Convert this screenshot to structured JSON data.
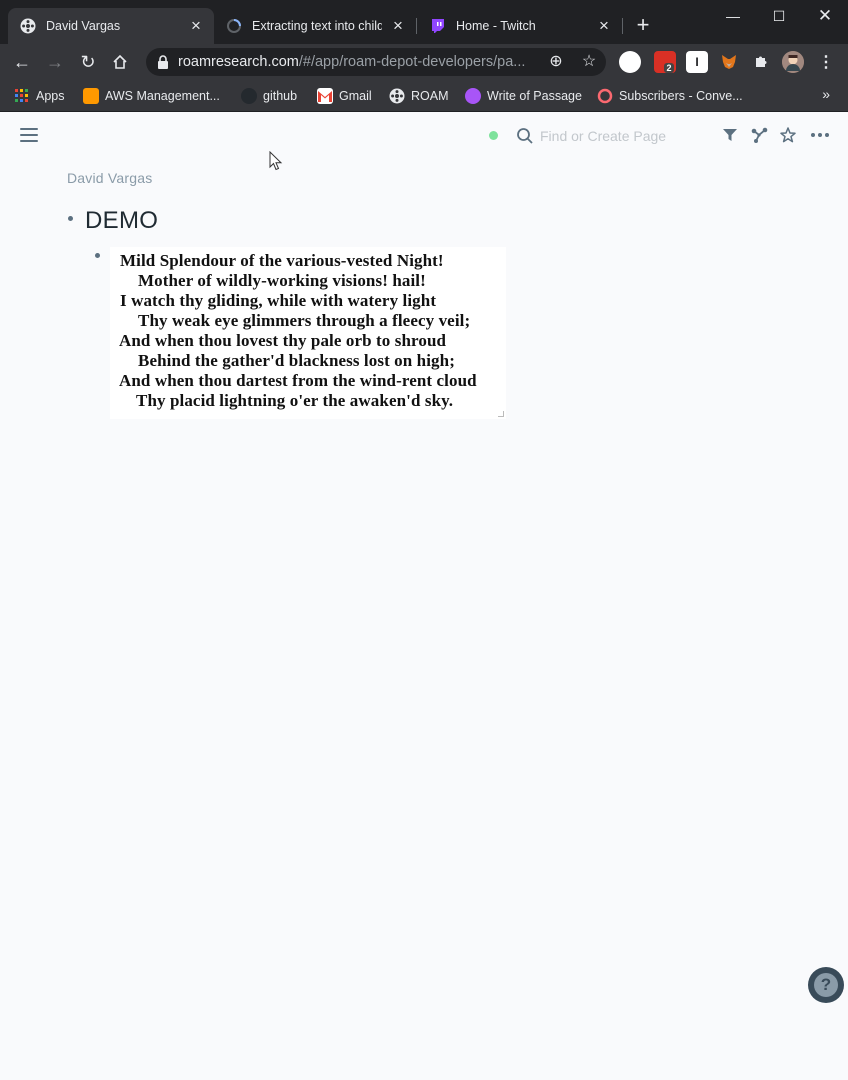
{
  "browser": {
    "tabs": [
      {
        "title": "David Vargas",
        "active": true
      },
      {
        "title": "Extracting text into child b",
        "active": false
      },
      {
        "title": "Home - Twitch",
        "active": false
      }
    ],
    "new_tab_label": "+",
    "url_host": "roamresearch.com",
    "url_path": "/#/app/roam-depot-developers/pa...",
    "extension_badge": "2",
    "extension_letter": "I",
    "bookmarks": [
      "Apps",
      "AWS Management...",
      "github",
      "Gmail",
      "ROAM",
      "Write of Passage",
      "Subscribers - Conve..."
    ],
    "bookmarks_more": "»"
  },
  "roam": {
    "search_placeholder": "Find or Create Page",
    "breadcrumb": "David Vargas",
    "page_title": "DEMO",
    "sync_color": "#7ee29c",
    "poem_lines": [
      "Mild Splendour of the various-vested Night!",
      "Mother of wildly-working visions! hail!",
      "I watch thy gliding, while with watery light",
      "Thy weak eye glimmers through a fleecy veil;",
      "And when thou lovest thy pale orb to shroud",
      "Behind the gather'd blackness lost on high;",
      "And when thou dartest from the wind-rent cloud",
      "Thy placid lightning o'er the awaken'd sky."
    ],
    "help_label": "?"
  }
}
